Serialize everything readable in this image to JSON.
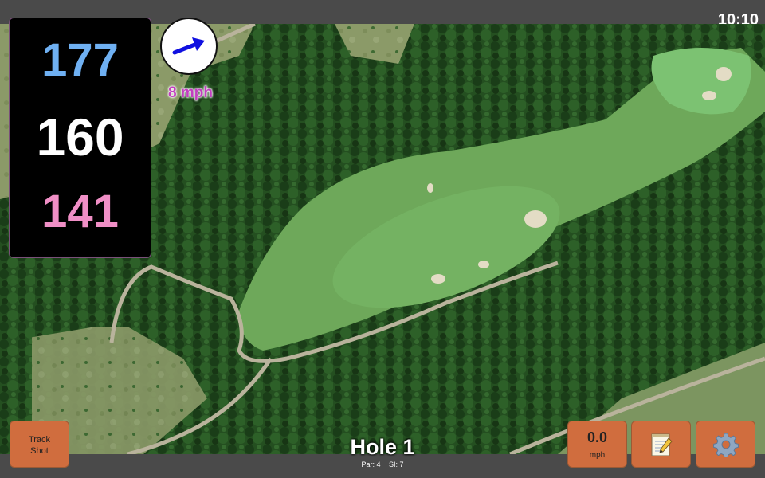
{
  "status_bar": {
    "time": "10:10"
  },
  "yardages": {
    "back": "177",
    "middle": "160",
    "front": "141",
    "colors": {
      "back": "#6fb0f2",
      "middle": "#ffffff",
      "front": "#f08fc6"
    }
  },
  "wind": {
    "speed_label": "8 mph",
    "direction_icon": "arrow-east-northeast-icon",
    "arrow_color": "#1010e0",
    "label_color": "#c23fc0"
  },
  "hole": {
    "title": "Hole 1",
    "par": "Par: 4",
    "stroke_index": "SI: 7"
  },
  "buttons": {
    "track_shot_line1": "Track",
    "track_shot_line2": "Shot",
    "speed_value": "0.0",
    "speed_unit": "mph",
    "notes_icon": "notepad-icon",
    "settings_icon": "gear-icon",
    "color": "#d06d3e"
  },
  "map": {
    "fairway_color": "#6ea85a",
    "green_color": "#7cc272",
    "forest_color": "#1f4a1c"
  }
}
